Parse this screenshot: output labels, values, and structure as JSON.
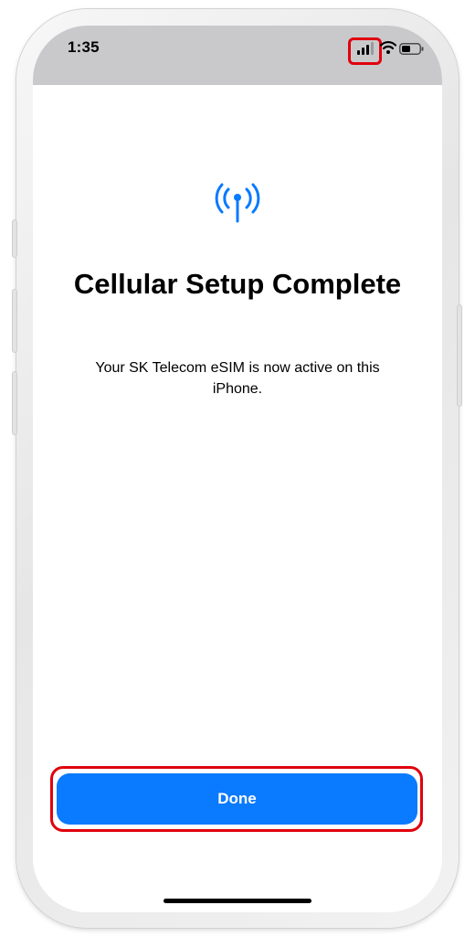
{
  "status_bar": {
    "time": "1:35",
    "signal_icon": "cellular-signal-icon",
    "wifi_icon": "wifi-icon",
    "battery_icon": "battery-icon"
  },
  "main": {
    "icon": "antenna-signal-icon",
    "title": "Cellular Setup Complete",
    "message": "Your SK Telecom eSIM is now active on this iPhone."
  },
  "actions": {
    "done_label": "Done"
  },
  "colors": {
    "accent": "#0a7aff",
    "highlight": "#e0000d",
    "status_bar_bg": "#c9c9cb"
  }
}
